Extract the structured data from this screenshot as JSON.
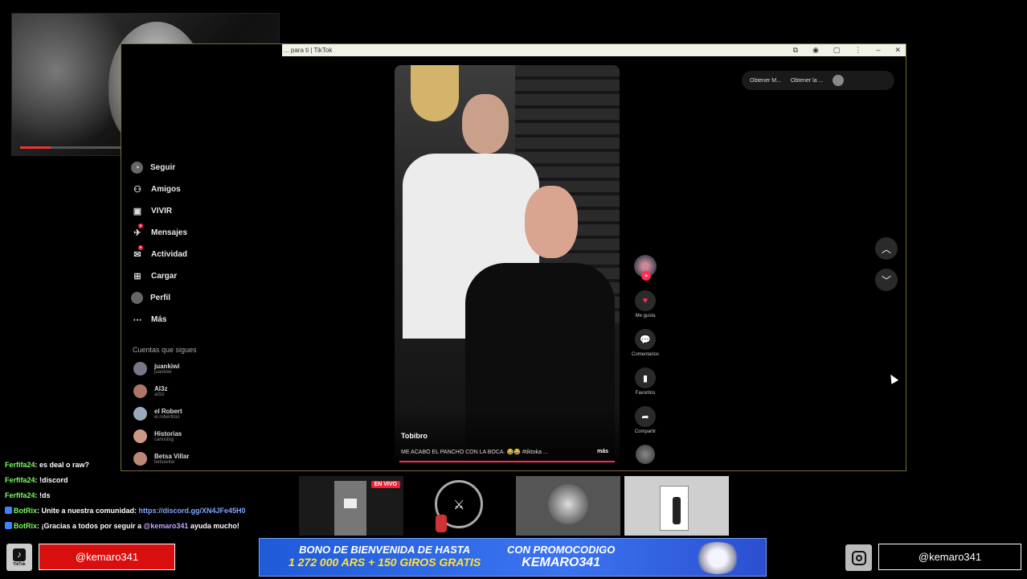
{
  "browser": {
    "tab_title": "... para ti | TikTok",
    "window_controls": [
      "⧉",
      "◉",
      "▢",
      "⋮",
      "–",
      "✕"
    ]
  },
  "sidebar": {
    "items": [
      {
        "label": "Seguir",
        "icon": "follow-icon"
      },
      {
        "label": "Amigos",
        "icon": "friends-icon"
      },
      {
        "label": "VIVIR",
        "icon": "live-icon"
      },
      {
        "label": "Mensajes",
        "icon": "messages-icon"
      },
      {
        "label": "Actividad",
        "icon": "activity-icon"
      },
      {
        "label": "Cargar",
        "icon": "upload-icon"
      },
      {
        "label": "Perfil",
        "icon": "profile-icon"
      },
      {
        "label": "Más",
        "icon": "more-icon"
      }
    ],
    "following_title": "Cuentas que sigues",
    "accounts": [
      {
        "name": "juankiwi",
        "sub": "juankiwi"
      },
      {
        "name": "Al3z",
        "sub": "al3zr"
      },
      {
        "name": "el Robert",
        "sub": "el.robertitoo"
      },
      {
        "name": "Historias",
        "sub": "carlosbqj"
      },
      {
        "name": "Betsa Villar",
        "sub": "betsavilar"
      }
    ]
  },
  "video": {
    "author": "Tobibro",
    "caption": "ME ACABÓ EL PANCHO CON LA BOCA. 😂😂 #tiktoka ...",
    "more_label": "más"
  },
  "actions": {
    "like_label": "Me gusta",
    "comment_label": "Comentarios",
    "save_label": "Favoritos",
    "share_label": "Compartir"
  },
  "top_buttons": {
    "btn1": "Obtener M...",
    "btn2": "Obtener la ..."
  },
  "chat": [
    {
      "user": "Ferfifa24",
      "text": ": es deal o raw?"
    },
    {
      "user": "Ferfifa24",
      "text": ": !discord"
    },
    {
      "user": "Ferfifa24",
      "text": ": !ds"
    },
    {
      "user": "BotRix",
      "text": ": Unite a nuestra comunidad: ",
      "link": "https://discord.gg/XN4JFe45H0"
    },
    {
      "user": "BotRix",
      "text": ": ¡Gracias a todos por seguir a ",
      "mention": "@kemaro341",
      "after": " ayuda mucho!"
    }
  ],
  "thumbs": {
    "live_badge": "EN VIVO"
  },
  "bottom": {
    "tiktok_text": "TikTok",
    "tiktok_handle": "@kemaro341",
    "instagram_handle": "@kemaro341",
    "promo_line1a": "BONO DE BIENVENIDA DE HASTA",
    "promo_line2a": "1 272 000 ARS + 150 GIROS GRATIS",
    "promo_line1b": "CON PROMOCODIGO",
    "promo_line2b": "KEMARO341"
  },
  "colors": {
    "tiktok_red": "#d90f0f",
    "chat_user": "#7cfc63",
    "promo_blue": "#1f5bd8",
    "promo_yellow": "#ffe03a",
    "tiktok_pink": "#fe2c55"
  }
}
